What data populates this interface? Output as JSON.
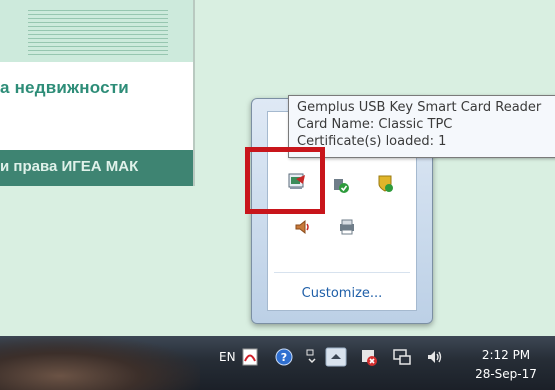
{
  "desktop": {
    "document": {
      "subtitle": "а недвижности",
      "bar_text": "и права ИГЕА МАК"
    }
  },
  "tray_overflow": {
    "customize_label": "Customize...",
    "icons": [
      "smart-card-reader-icon",
      "security-shield-icon",
      "update-shield-icon",
      "volume-icon",
      "network-printer-icon"
    ]
  },
  "tooltip": {
    "title": "Gemplus USB Key Smart Card Reader",
    "card_name": "Card Name: Classic TPC",
    "certificates": "Certificate(s) loaded: 1"
  },
  "taskbar": {
    "language": "EN",
    "clock": {
      "time": "2:12 PM",
      "date": "28-Sep-17"
    }
  },
  "colors": {
    "highlight": "#c8151b",
    "link": "#1f5fa8",
    "desktop_bg": "#d9efe1"
  }
}
